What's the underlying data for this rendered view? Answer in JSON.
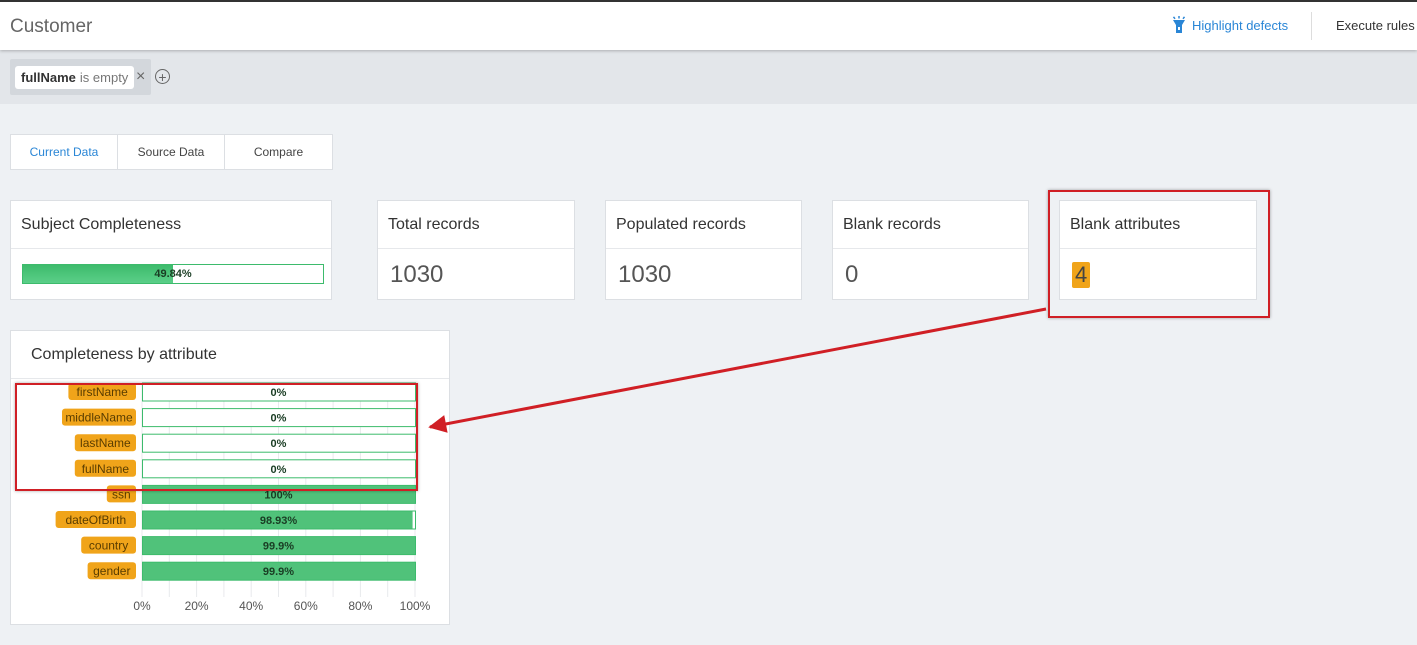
{
  "header": {
    "title": "Customer",
    "highlight_label": "Highlight defects",
    "execute_label": "Execute rules",
    "accent": "#2a86d6"
  },
  "filter": {
    "attribute": "fullName",
    "condition": "is empty",
    "remove_icon": "close-icon",
    "add_icon": "plus-circle-icon"
  },
  "tabs": [
    {
      "label": "Current Data",
      "active": true
    },
    {
      "label": "Source Data",
      "active": false
    },
    {
      "label": "Compare",
      "active": false
    }
  ],
  "stats": {
    "subject_completeness": {
      "title": "Subject Completeness",
      "percent": 49.84,
      "label": "49.84%"
    },
    "total_records": {
      "title": "Total records",
      "value": "1030"
    },
    "populated_records": {
      "title": "Populated records",
      "value": "1030"
    },
    "blank_records": {
      "title": "Blank records",
      "value": "0"
    },
    "blank_attributes": {
      "title": "Blank attributes",
      "value": "4"
    }
  },
  "chart_data": {
    "type": "bar",
    "title": "Completeness by attribute",
    "orientation": "horizontal",
    "categories": [
      "firstName",
      "middleName",
      "lastName",
      "fullName",
      "ssn",
      "dateOfBirth",
      "country",
      "gender"
    ],
    "values": [
      0,
      0,
      0,
      0,
      100,
      98.93,
      99.9,
      99.9
    ],
    "value_labels": [
      "0%",
      "0%",
      "0%",
      "0%",
      "100%",
      "98.93%",
      "99.9%",
      "99.9%"
    ],
    "xlim": [
      0,
      100
    ],
    "xticks": [
      "0%",
      "20%",
      "40%",
      "60%",
      "80%",
      "100%"
    ],
    "grid": true,
    "colors": {
      "bar": "#3dbb6c",
      "label_bg": "#f0a41a"
    }
  },
  "annotation": {
    "color": "#d01f25"
  }
}
